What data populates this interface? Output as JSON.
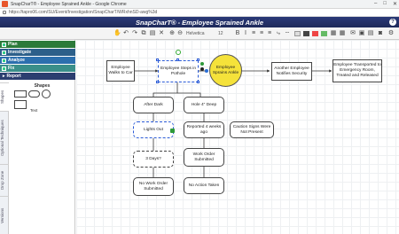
{
  "browser": {
    "title": "SnapCharT® - Employee Sprained Ankle - Google Chrome",
    "url": "https://tapro06.com/SU/Event/Investigation/SnapCharT/WRxhnSD-awg%3d",
    "window_controls": [
      "–",
      "□",
      "✕"
    ]
  },
  "app": {
    "title": "SnapCharT® - Employee Sprained Ankle",
    "help_label": "?"
  },
  "toolbar": {
    "font_family": "Helvetica",
    "font_size": "12"
  },
  "menu": {
    "items": [
      {
        "label": "Plan",
        "checked": true
      },
      {
        "label": "Investigate",
        "checked": true
      },
      {
        "label": "Analyze",
        "checked": true
      },
      {
        "label": "Fix",
        "checked": true
      },
      {
        "label": "Report",
        "checked": false
      }
    ]
  },
  "side_tabs": [
    "Shapes",
    "Optional Techniques",
    "Drop Zone",
    "Versions"
  ],
  "shapes_panel": {
    "heading": "Shapes",
    "text_sample": "Text"
  },
  "diagram": {
    "nodes": {
      "walks": "Employee Walks to Car",
      "steps": "Employee Steps in Pothole",
      "sprains": "Employee Sprains Ankle",
      "another": "Another Employee Notifies Security",
      "transported": "Employee Transported to Emergency Room, Treated and Released",
      "after_dark": "After Dark",
      "hole": "Hole 4\" Deep",
      "lights": "Lights Out",
      "reported": "Reported 4 weeks ago",
      "caution": "Caution Signs Were Not Present",
      "three_days": "3 Days?",
      "work_order": "Work Order Submitted",
      "no_work_order": "No Work Order Submitted",
      "no_action": "No Action Taken"
    }
  },
  "colors": {
    "header": "#1e2a5a",
    "plan": "#2c7a3a",
    "investigate": "#2c5f8a",
    "analyze": "#2c6fae",
    "fix": "#3a8f8a",
    "report": "#2c3e70",
    "incident": "#f5e23a"
  }
}
